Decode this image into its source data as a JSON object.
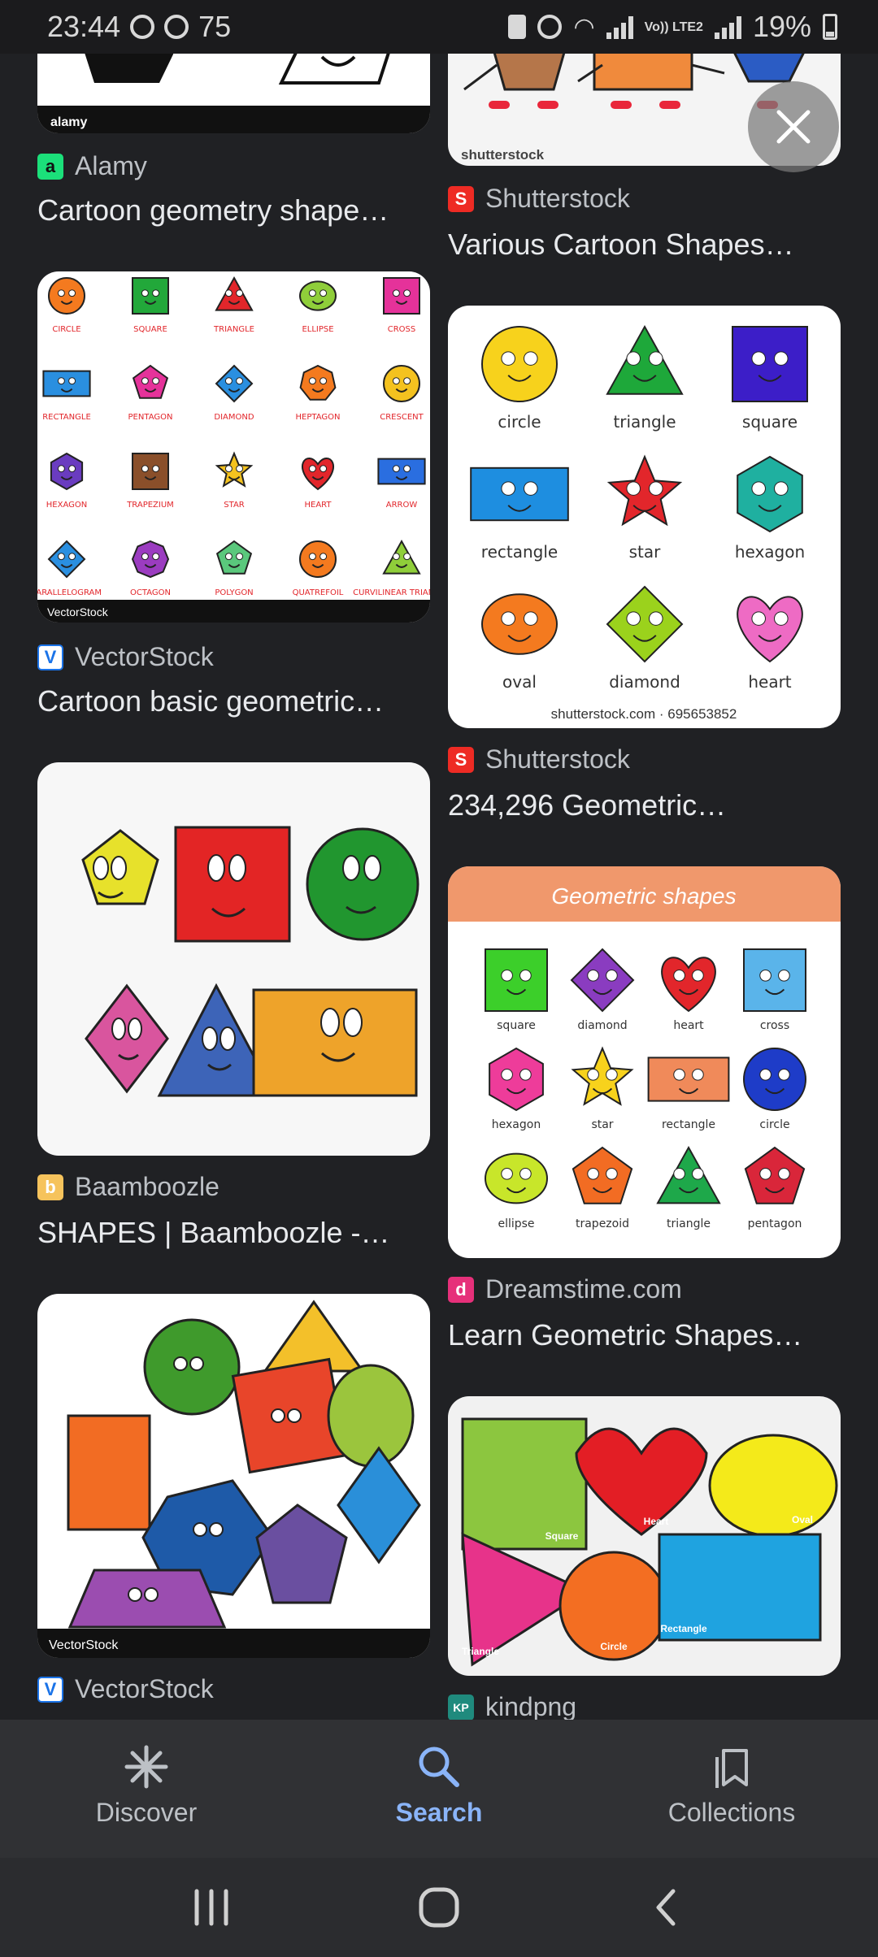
{
  "status_bar": {
    "time": "23:44",
    "notif_count": "75",
    "network": "Vo)) LTE2",
    "battery": "19%"
  },
  "results": [
    {
      "source": "Alamy",
      "title": "Cartoon geometry shape…",
      "favicon_color": "#1be07a",
      "favicon_letter": "a",
      "watermark": "alamy"
    },
    {
      "source": "Shutterstock",
      "title": "Various Cartoon Shapes…",
      "favicon_color": "#ee2b24",
      "favicon_letter": "S",
      "watermark": "shutterstock"
    },
    {
      "source": "VectorStock",
      "title": "Cartoon basic geometric…",
      "favicon_color": "#ffffff",
      "favicon_letter": "V",
      "watermark": "VectorStock"
    },
    {
      "source": "Shutterstock",
      "title": "234,296 Geometric…",
      "favicon_color": "#ee2b24",
      "favicon_letter": "S",
      "watermark": "shutterstock.com · 695653852"
    },
    {
      "source": "Baamboozle",
      "title": "SHAPES | Baamboozle -…",
      "favicon_color": "#f6c35c",
      "favicon_letter": "b"
    },
    {
      "source": "Dreamstime.com",
      "title": "Learn Geometric Shapes…",
      "favicon_color": "#e6307a",
      "favicon_letter": "d",
      "banner": "Geometric shapes"
    },
    {
      "source": "VectorStock",
      "title": "",
      "favicon_color": "#ffffff",
      "favicon_letter": "V",
      "watermark": "VectorStock"
    },
    {
      "source": "kindpng",
      "title": "",
      "favicon_color": "#1f8a7d",
      "favicon_letter": "KP"
    }
  ],
  "grid_labels": {
    "vectorstock_shapes": [
      "CIRCLE",
      "SQUARE",
      "TRIANGLE",
      "ELLIPSE",
      "CROSS",
      "RECTANGLE",
      "PENTAGON",
      "DIAMOND",
      "HEPTAGON",
      "CRESCENT",
      "HEXAGON",
      "TRAPEZIUM",
      "STAR",
      "HEART",
      "ARROW",
      "PARALLELOGRAM",
      "OCTAGON",
      "POLYGON",
      "QUATREFOIL",
      "CURVILINEAR TRIANGLE"
    ],
    "shutterstock_shapes": [
      "circle",
      "triangle",
      "square",
      "rectangle",
      "star",
      "hexagon",
      "oval",
      "diamond",
      "heart"
    ],
    "dreamstime_shapes": [
      "square",
      "diamond",
      "heart",
      "cross",
      "hexagon",
      "star",
      "rectangle",
      "circle",
      "ellipse",
      "trapezoid",
      "triangle",
      "pentagon"
    ],
    "kindpng_shapes": [
      "Square",
      "Heart",
      "Oval",
      "Triangle",
      "Circle",
      "Rectangle"
    ]
  },
  "bottom_nav": [
    {
      "label": "Discover",
      "icon": "asterisk-icon",
      "active": false
    },
    {
      "label": "Search",
      "icon": "search-icon",
      "active": true
    },
    {
      "label": "Collections",
      "icon": "collections-icon",
      "active": false
    }
  ],
  "colors": {
    "background": "#202124",
    "accent": "#8ab4f8",
    "text": "#e8eaed",
    "secondary": "#bdc1c6"
  }
}
